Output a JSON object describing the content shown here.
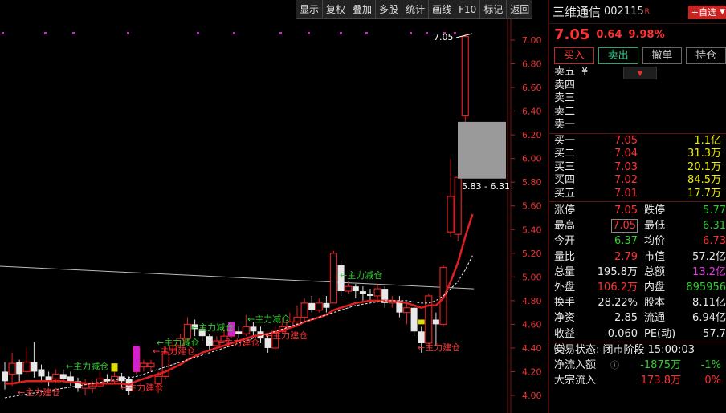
{
  "toolbar": {
    "buttons": [
      "显示",
      "复权",
      "叠加",
      "多股",
      "统计",
      "画线",
      "F10",
      "标记",
      "返回"
    ]
  },
  "chart_data": {
    "type": "candlestick",
    "y_axis": {
      "min": 4.0,
      "max": 7.0,
      "ticks": [
        "7.00",
        "6.80",
        "6.60",
        "6.40",
        "6.20",
        "6.00",
        "5.80",
        "5.60",
        "5.40",
        "5.20",
        "5.00",
        "4.80",
        "4.60",
        "4.40",
        "4.20",
        "4.00"
      ]
    },
    "high_label": "7.05",
    "selection_box_label": "5.83 - 6.31",
    "annotations": [
      {
        "text": "←主力减仓",
        "color": "#3c3"
      },
      {
        "text": "←主力减仓",
        "color": "#3c3"
      },
      {
        "text": "←主力减仓",
        "color": "#3c3"
      },
      {
        "text": "←主力减仓",
        "color": "#3c3"
      },
      {
        "text": "←主力减仓",
        "color": "#3c3"
      },
      {
        "text": "←主力建仓",
        "color": "#f33"
      },
      {
        "text": "←主力建仓",
        "color": "#f33"
      },
      {
        "text": "←主力建仓",
        "color": "#f33"
      },
      {
        "text": "←主力建仓",
        "color": "#f33"
      },
      {
        "text": "←主力建仓",
        "color": "#f33"
      },
      {
        "text": "←主力建仓",
        "color": "#f33"
      }
    ],
    "candles": [
      {
        "o": 4.2,
        "c": 4.12,
        "h": 4.28,
        "l": 4.05
      },
      {
        "o": 4.18,
        "c": 4.27,
        "h": 4.36,
        "l": 4.08
      },
      {
        "o": 4.28,
        "c": 4.18,
        "h": 4.3,
        "l": 4.1
      },
      {
        "o": 4.2,
        "c": 4.28,
        "h": 4.4,
        "l": 4.18
      },
      {
        "o": 4.28,
        "c": 4.2,
        "h": 4.45,
        "l": 4.15
      },
      {
        "o": 4.22,
        "c": 4.16,
        "h": 4.26,
        "l": 4.12
      },
      {
        "o": 4.16,
        "c": 4.12,
        "h": 4.2,
        "l": 4.08
      },
      {
        "o": 4.14,
        "c": 4.18,
        "h": 4.22,
        "l": 4.1
      },
      {
        "o": 4.18,
        "c": 4.14,
        "h": 4.22,
        "l": 4.1
      },
      {
        "o": 4.16,
        "c": 4.12,
        "h": 4.2,
        "l": 4.08
      },
      {
        "o": 4.12,
        "c": 4.06,
        "h": 4.15,
        "l": 4.03
      },
      {
        "o": 4.06,
        "c": 4.1,
        "h": 4.14,
        "l": 4.0
      },
      {
        "o": 4.06,
        "c": 4.08,
        "h": 4.12,
        "l": 4.02
      },
      {
        "o": 4.08,
        "c": 4.14,
        "h": 4.2,
        "l": 4.06
      },
      {
        "o": 4.14,
        "c": 4.12,
        "h": 4.18,
        "l": 4.1
      },
      {
        "o": 4.12,
        "c": 4.16,
        "h": 4.2,
        "l": 4.1
      },
      {
        "o": 4.16,
        "c": 4.12,
        "h": 4.19,
        "l": 4.06
      },
      {
        "o": 4.14,
        "c": 4.04,
        "h": 4.16,
        "l": 4.0
      },
      {
        "o": 4.2,
        "c": 4.4,
        "h": 4.42,
        "l": 4.18
      },
      {
        "o": 4.24,
        "c": 4.27,
        "h": 4.3,
        "l": 4.2
      },
      {
        "o": 4.24,
        "c": 4.27,
        "h": 4.3,
        "l": 4.2
      },
      {
        "o": 4.1,
        "c": 4.16,
        "h": 4.2,
        "l": 4.02
      },
      {
        "o": 4.16,
        "c": 4.36,
        "h": 4.42,
        "l": 4.14
      },
      {
        "o": 4.38,
        "c": 4.42,
        "h": 4.46,
        "l": 4.35
      },
      {
        "o": 4.42,
        "c": 4.48,
        "h": 4.52,
        "l": 4.4
      },
      {
        "o": 4.48,
        "c": 4.6,
        "h": 4.66,
        "l": 4.46
      },
      {
        "o": 4.6,
        "c": 4.56,
        "h": 4.64,
        "l": 4.5
      },
      {
        "o": 4.56,
        "c": 4.5,
        "h": 4.58,
        "l": 4.46
      },
      {
        "o": 4.5,
        "c": 4.42,
        "h": 4.52,
        "l": 4.38
      },
      {
        "o": 4.42,
        "c": 4.46,
        "h": 4.5,
        "l": 4.4
      },
      {
        "o": 4.46,
        "c": 4.5,
        "h": 4.56,
        "l": 4.44
      },
      {
        "o": 4.5,
        "c": 4.56,
        "h": 4.62,
        "l": 4.48
      },
      {
        "o": 4.54,
        "c": 4.52,
        "h": 4.58,
        "l": 4.48
      },
      {
        "o": 4.52,
        "c": 4.58,
        "h": 4.68,
        "l": 4.5
      },
      {
        "o": 4.58,
        "c": 4.54,
        "h": 4.62,
        "l": 4.48
      },
      {
        "o": 4.54,
        "c": 4.48,
        "h": 4.58,
        "l": 4.44
      },
      {
        "o": 4.48,
        "c": 4.4,
        "h": 4.52,
        "l": 4.36
      },
      {
        "o": 4.4,
        "c": 4.54,
        "h": 4.58,
        "l": 4.38
      },
      {
        "o": 4.54,
        "c": 4.58,
        "h": 4.66,
        "l": 4.52
      },
      {
        "o": 4.58,
        "c": 4.62,
        "h": 4.7,
        "l": 4.56
      },
      {
        "o": 4.62,
        "c": 4.66,
        "h": 4.76,
        "l": 4.58
      },
      {
        "o": 4.66,
        "c": 4.78,
        "h": 4.82,
        "l": 4.62
      },
      {
        "o": 4.78,
        "c": 4.72,
        "h": 4.84,
        "l": 4.7
      },
      {
        "o": 4.72,
        "c": 4.78,
        "h": 4.82,
        "l": 4.7
      },
      {
        "o": 4.78,
        "c": 4.74,
        "h": 4.84,
        "l": 4.7
      },
      {
        "o": 4.78,
        "c": 5.2,
        "h": 5.22,
        "l": 4.78
      },
      {
        "o": 5.1,
        "c": 4.88,
        "h": 5.14,
        "l": 4.84
      },
      {
        "o": 4.88,
        "c": 4.92,
        "h": 4.96,
        "l": 4.86
      },
      {
        "o": 4.92,
        "c": 4.88,
        "h": 4.94,
        "l": 4.82
      },
      {
        "o": 4.88,
        "c": 4.86,
        "h": 4.92,
        "l": 4.8
      },
      {
        "o": 4.86,
        "c": 4.84,
        "h": 4.9,
        "l": 4.8
      },
      {
        "o": 4.84,
        "c": 4.9,
        "h": 4.94,
        "l": 4.78
      },
      {
        "o": 4.9,
        "c": 4.78,
        "h": 4.92,
        "l": 4.74
      },
      {
        "o": 4.78,
        "c": 4.8,
        "h": 4.84,
        "l": 4.74
      },
      {
        "o": 4.8,
        "c": 4.7,
        "h": 4.84,
        "l": 4.66
      },
      {
        "o": 4.7,
        "c": 4.74,
        "h": 4.78,
        "l": 4.6
      },
      {
        "o": 4.74,
        "c": 4.54,
        "h": 4.76,
        "l": 4.5
      },
      {
        "o": 4.54,
        "c": 4.44,
        "h": 4.58,
        "l": 4.36
      },
      {
        "o": 4.44,
        "c": 4.84,
        "h": 4.86,
        "l": 4.4
      },
      {
        "o": 4.64,
        "c": 4.6,
        "h": 4.7,
        "l": 4.42
      },
      {
        "o": 4.6,
        "c": 5.08,
        "h": 5.1,
        "l": 4.58
      },
      {
        "o": 5.38,
        "c": 5.68,
        "h": 6.0,
        "l": 5.34
      },
      {
        "o": 5.36,
        "c": 5.84,
        "h": 5.84,
        "l": 5.3
      },
      {
        "o": 6.36,
        "c": 7.03,
        "h": 7.05,
        "l": 6.3
      }
    ],
    "ma_red": [
      4.1,
      4.1,
      4.11,
      4.12,
      4.12,
      4.12,
      4.12,
      4.12,
      4.12,
      4.11,
      4.11,
      4.1,
      4.1,
      4.1,
      4.1,
      4.1,
      4.1,
      4.09,
      4.12,
      4.14,
      4.16,
      4.18,
      4.2,
      4.23,
      4.26,
      4.3,
      4.33,
      4.36,
      4.38,
      4.4,
      4.42,
      4.44,
      4.46,
      4.48,
      4.5,
      4.51,
      4.52,
      4.53,
      4.55,
      4.57,
      4.59,
      4.62,
      4.64,
      4.66,
      4.68,
      4.72,
      4.74,
      4.76,
      4.78,
      4.79,
      4.8,
      4.8,
      4.8,
      4.8,
      4.79,
      4.78,
      4.76,
      4.74,
      4.76,
      4.76,
      4.82,
      4.96,
      5.12,
      5.34,
      5.53
    ],
    "ma_white_dash": [
      3.98,
      3.99,
      4.0,
      4.01,
      4.02,
      4.03,
      4.04,
      4.05,
      4.06,
      4.07,
      4.08,
      4.09,
      4.1,
      4.11,
      4.12,
      4.13,
      4.14,
      4.15,
      4.16,
      4.18,
      4.2,
      4.22,
      4.24,
      4.26,
      4.28,
      4.3,
      4.32,
      4.34,
      4.36,
      4.38,
      4.4,
      4.42,
      4.44,
      4.46,
      4.48,
      4.5,
      4.52,
      4.54,
      4.56,
      4.58,
      4.6,
      4.62,
      4.64,
      4.66,
      4.68,
      4.7,
      4.72,
      4.74,
      4.76,
      4.77,
      4.78,
      4.79,
      4.8,
      4.8,
      4.8,
      4.8,
      4.79,
      4.78,
      4.78,
      4.8,
      4.84,
      4.9,
      4.96,
      5.06,
      5.18
    ],
    "ma_long": {
      "from": 5.09,
      "to": 4.9
    }
  },
  "panel": {
    "stock_name": "三维通信",
    "stock_code": "002115",
    "stock_flag": "R",
    "fav_button": "+自选",
    "price": "7.05",
    "change": "0.64",
    "change_pct": "9.98%",
    "actions": [
      "买入",
      "卖出",
      "撤单",
      "持仓"
    ],
    "sell_book": [
      {
        "label": "卖五",
        "price": "",
        "vol": ""
      },
      {
        "label": "卖四",
        "price": "",
        "vol": ""
      },
      {
        "label": "卖三",
        "price": "",
        "vol": ""
      },
      {
        "label": "卖二",
        "price": "",
        "vol": ""
      },
      {
        "label": "卖一",
        "price": "",
        "vol": ""
      }
    ],
    "sell5_mark": "¥",
    "buy_book": [
      {
        "label": "买一",
        "price": "7.05",
        "vol": "1.1亿"
      },
      {
        "label": "买二",
        "price": "7.04",
        "vol": "31.3万"
      },
      {
        "label": "买三",
        "price": "7.03",
        "vol": "20.1万"
      },
      {
        "label": "买四",
        "price": "7.02",
        "vol": "84.5万"
      },
      {
        "label": "买五",
        "price": "7.01",
        "vol": "17.7万"
      }
    ],
    "stats": [
      {
        "k1": "涨停",
        "v1": "7.05",
        "c1": "c-red",
        "k2": "跌停",
        "v2": "5.77",
        "c2": "c-green"
      },
      {
        "k1": "最高",
        "v1": "7.05",
        "c1": "c-red boxed",
        "k2": "最低",
        "v2": "6.31",
        "c2": "c-green"
      },
      {
        "k1": "今开",
        "v1": "6.37",
        "c1": "c-green",
        "k2": "均价",
        "v2": "6.73",
        "c2": "c-red"
      },
      {
        "k1": "量比",
        "v1": "2.79",
        "c1": "c-red",
        "k2": "市值",
        "v2": "57.2亿",
        "c2": "c-white"
      },
      {
        "k1": "总量",
        "v1": "195.8万",
        "c1": "c-white",
        "k2": "总额",
        "v2": "13.2亿",
        "c2": "c-mag"
      },
      {
        "k1": "外盘",
        "v1": "106.2万",
        "c1": "c-red",
        "k2": "内盘",
        "v2": "895956",
        "c2": "c-green"
      },
      {
        "k1": "换手",
        "v1": "28.22%",
        "c1": "c-white",
        "k2": "股本",
        "v2": "8.11亿",
        "c2": "c-white"
      },
      {
        "k1": "净资",
        "v1": "2.85",
        "c1": "c-white",
        "k2": "流通",
        "v2": "6.94亿",
        "c2": "c-white"
      },
      {
        "k1": "收益㈢",
        "v1": "0.060",
        "c1": "c-white",
        "k2": "PE(动)",
        "v2": "57.7",
        "c2": "c-white"
      }
    ],
    "trade_status": "交易状态: 闭市阶段 15:00:03",
    "flow": [
      {
        "k": "净流入额",
        "v": "-1875万",
        "cv": "c-green",
        "p": "-1%",
        "cp": "c-green"
      },
      {
        "k": "大宗流入",
        "v": "173.8万",
        "cv": "c-red",
        "p": "0%",
        "cp": "c-red"
      }
    ]
  }
}
